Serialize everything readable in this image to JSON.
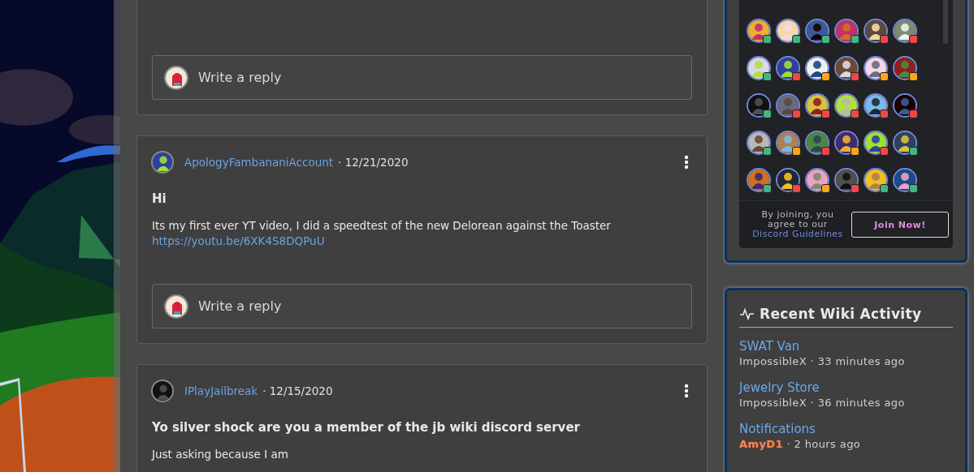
{
  "comments": [
    {
      "reply_placeholder": "Write a reply"
    },
    {
      "author": "ApologyFambananiAccount",
      "date": "· 12/21/2020",
      "title": "Hi",
      "body": "Its my first ever YT video, I did a speedtest of the new Delorean against the Toaster",
      "link": "https://youtu.be/6XK4S8DQPuU",
      "reply_placeholder": "Write a reply"
    },
    {
      "author": "IPlayJailbreak",
      "date": "· 12/15/2020",
      "title": "Yo silver shock are you a member of the jb wiki discord server",
      "body": "Just asking because I am"
    }
  ],
  "discord": {
    "members": [
      {
        "color": "#43b581"
      },
      {
        "color": "#43b581"
      },
      {
        "color": "#43b581"
      },
      {
        "color": "#43b581"
      },
      {
        "color": "#f04747"
      },
      {
        "color": "#f04747"
      },
      {
        "color": "#43b581"
      },
      {
        "color": "#f04747"
      },
      {
        "color": "#faa61a"
      },
      {
        "color": "#f04747"
      },
      {
        "color": "#faa61a"
      },
      {
        "color": "#faa61a"
      },
      {
        "color": "#43b581"
      },
      {
        "color": "#f04747"
      },
      {
        "color": "#f04747"
      },
      {
        "color": "#f04747"
      },
      {
        "color": "#f04747"
      },
      {
        "color": "#f04747"
      },
      {
        "color": "#43b581"
      },
      {
        "color": "#faa61a"
      },
      {
        "color": "#f04747"
      },
      {
        "color": "#faa61a"
      },
      {
        "color": "#f04747"
      },
      {
        "color": "#43b581"
      },
      {
        "color": "#43b581"
      },
      {
        "color": "#f04747"
      },
      {
        "color": "#faa61a"
      },
      {
        "color": "#f04747"
      },
      {
        "color": "#43b581"
      },
      {
        "color": "#43b581"
      }
    ],
    "disclaimer": "By joining, you agree to our",
    "guidelines_link": "Discord Guidelines",
    "join_button": "Join Now!"
  },
  "recent_activity": {
    "title": "Recent Wiki Activity",
    "items": [
      {
        "page": "SWAT Van",
        "user": "ImpossibleX",
        "time": "· 33 minutes ago",
        "user_highlighted": false
      },
      {
        "page": "Jewelry Store",
        "user": "ImpossibleX",
        "time": "· 36 minutes ago",
        "user_highlighted": false
      },
      {
        "page": "Notifications",
        "user": "AmyD1",
        "time": "· 2 hours ago",
        "user_highlighted": true
      }
    ]
  }
}
